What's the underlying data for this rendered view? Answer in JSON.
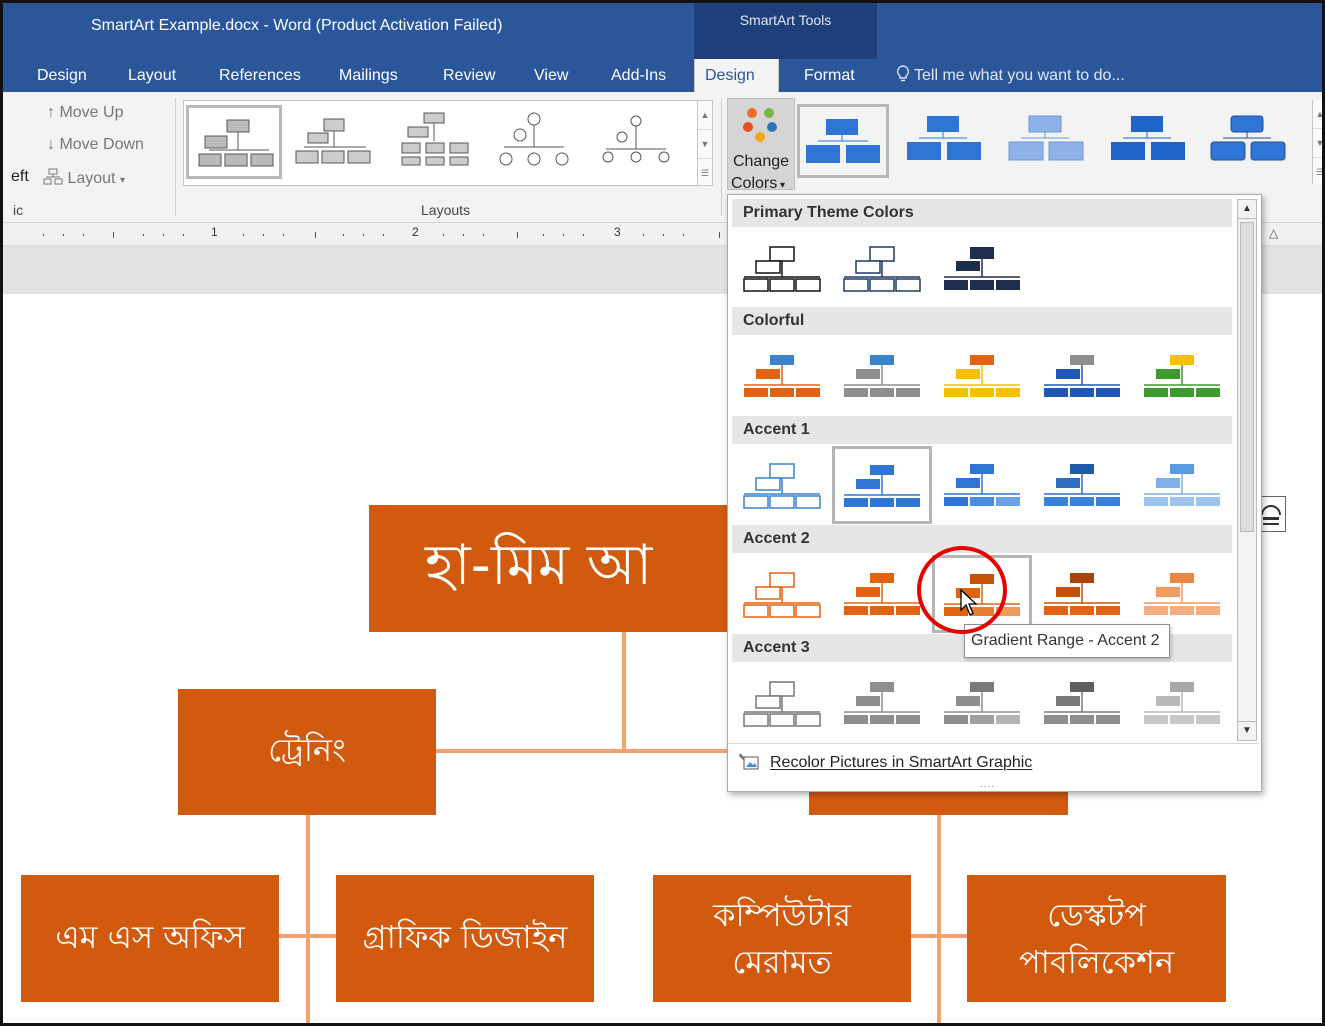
{
  "window": {
    "title": "SmartArt Example.docx - Word (Product Activation Failed)",
    "context_group": "SmartArt Tools"
  },
  "tabs": [
    {
      "label": "Design"
    },
    {
      "label": "Layout"
    },
    {
      "label": "References"
    },
    {
      "label": "Mailings"
    },
    {
      "label": "Review"
    },
    {
      "label": "View"
    },
    {
      "label": "Add-Ins"
    },
    {
      "label": "Design",
      "active": true
    },
    {
      "label": "Format"
    }
  ],
  "tell_me": "Tell me what you want to do...",
  "ribbon": {
    "move_up": "Move Up",
    "move_down": "Move Down",
    "left_fragment": "eft",
    "layout": "Layout",
    "left_group_fragment": "ic",
    "layouts_group": "Layouts",
    "change_colors_line1": "Change",
    "change_colors_line2": "Colors"
  },
  "ruler_numbers": [
    "1",
    "2",
    "3"
  ],
  "dropdown": {
    "sections": [
      "Primary Theme Colors",
      "Colorful",
      "Accent 1",
      "Accent 2",
      "Accent 3"
    ],
    "recolor": "Recolor Pictures in SmartArt Graphic",
    "tooltip": "Gradient Range - Accent 2"
  },
  "smartart": {
    "top": "হা-মিম আ",
    "training": "ট্রেনিং",
    "ms_office": "এম এস অফিস",
    "graphic_design": "গ্রাফিক ডিজাইন",
    "computer_repair_1": "কম্পিউটার",
    "computer_repair_2": "মেরামত",
    "desktop_pub_1": "ডেস্কটপ",
    "desktop_pub_2": "পাবলিকেশন"
  },
  "colors": {
    "titlebar": "#2b579a",
    "smartart_box": "#d25a0f",
    "connector": "#f4a070",
    "accent1": "#3a82cc",
    "accent2": "#e2620f",
    "accent3": "#8e8e8e"
  }
}
